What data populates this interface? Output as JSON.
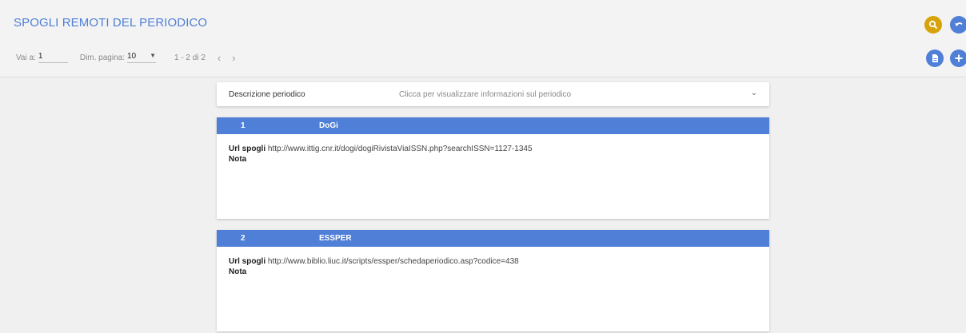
{
  "header": {
    "title": "SPOGLI REMOTI DEL PERIODICO"
  },
  "pager": {
    "goto_label": "Vai a:",
    "goto_value": "1",
    "size_label": "Dim. pagina:",
    "size_value": "10",
    "range": "1 - 2 di 2",
    "prev_icon": "chevron-left-icon",
    "next_icon": "chevron-right-icon"
  },
  "actions": {
    "search_icon": "search-icon",
    "back_icon": "undo-icon",
    "doc_icon": "document-icon",
    "add_icon": "plus-icon",
    "colors": {
      "search": "#d7a30b",
      "primary": "#4f7fd6"
    }
  },
  "description": {
    "label": "Descrizione periodico",
    "hint": "Clicca per visualizzare informazioni sul periodico"
  },
  "records": [
    {
      "index": "1",
      "name": "DoGi",
      "url_label": "Url spogli",
      "url": "http://www.ittig.cnr.it/dogi/dogiRivistaViaISSN.php?searchISSN=1127-1345",
      "note_label": "Nota"
    },
    {
      "index": "2",
      "name": "ESSPER",
      "url_label": "Url spogli",
      "url": "http://www.biblio.liuc.it/scripts/essper/schedaperiodico.asp?codice=438",
      "note_label": "Nota"
    }
  ]
}
